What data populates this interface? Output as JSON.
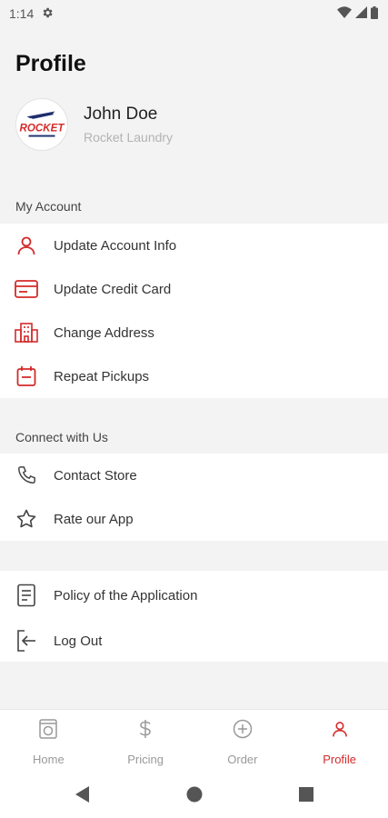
{
  "status_bar": {
    "time": "1:14"
  },
  "page": {
    "title": "Profile"
  },
  "profile": {
    "name": "John Doe",
    "company": "Rocket Laundry",
    "logo_text": "ROCKET"
  },
  "sections": {
    "my_account": {
      "header": "My Account",
      "items": [
        {
          "label": "Update Account Info",
          "icon": "person-icon"
        },
        {
          "label": "Update Credit Card",
          "icon": "credit-card-icon"
        },
        {
          "label": "Change Address",
          "icon": "building-icon"
        },
        {
          "label": "Repeat Pickups",
          "icon": "calendar-icon"
        }
      ]
    },
    "connect": {
      "header": "Connect with Us",
      "items": [
        {
          "label": "Contact Store",
          "icon": "phone-icon"
        },
        {
          "label": "Rate our App",
          "icon": "star-icon"
        }
      ]
    },
    "misc": {
      "items": [
        {
          "label": "Policy of the Application",
          "icon": "document-icon"
        },
        {
          "label": "Log Out",
          "icon": "logout-icon"
        }
      ]
    }
  },
  "bottom_nav": {
    "items": [
      {
        "label": "Home",
        "icon": "washer-icon",
        "active": false
      },
      {
        "label": "Pricing",
        "icon": "dollar-icon",
        "active": false
      },
      {
        "label": "Order",
        "icon": "plus-circle-icon",
        "active": false
      },
      {
        "label": "Profile",
        "icon": "person-icon",
        "active": true
      }
    ]
  },
  "colors": {
    "accent": "#d42a2a",
    "background": "#f3f3f3",
    "inactive": "#999999"
  }
}
